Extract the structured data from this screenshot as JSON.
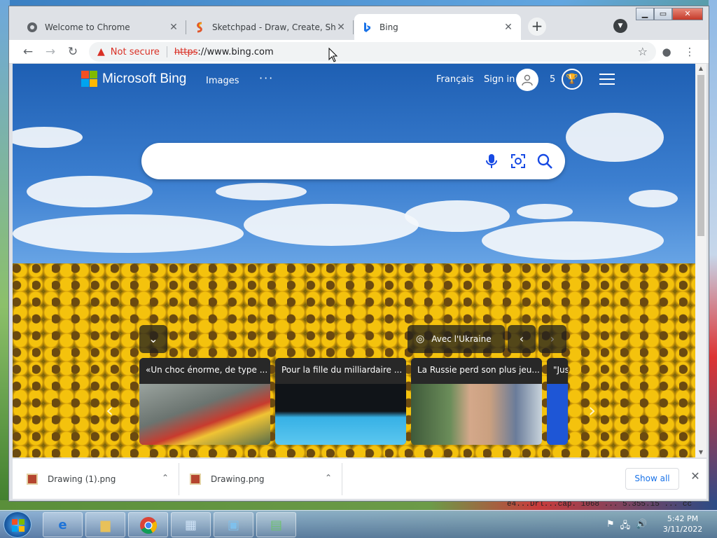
{
  "browser": {
    "tabs": [
      {
        "title": "Welcome to Chrome",
        "icon": "chrome-welcome-icon"
      },
      {
        "title": "Sketchpad - Draw, Create, Share!",
        "icon": "sketchpad-icon"
      },
      {
        "title": "Bing",
        "icon": "bing-icon"
      }
    ],
    "omnibox": {
      "security_label": "Not secure",
      "scheme": "https",
      "rest": "://www.bing.com"
    }
  },
  "bing": {
    "brand": "Microsoft Bing",
    "nav": {
      "images": "Images",
      "more": "···",
      "language": "Français",
      "signin": "Sign in",
      "points": "5"
    },
    "search": {
      "placeholder": ""
    },
    "carousel": {
      "location_label": "Avec l'Ukraine",
      "cards": [
        {
          "caption": "«Un choc énorme, de type ..."
        },
        {
          "caption": "Pour la fille du milliardaire ..."
        },
        {
          "caption": "La Russie perd son plus jeu..."
        },
        {
          "caption": "\"Jus"
        }
      ]
    }
  },
  "downloads": {
    "items": [
      {
        "name": "Drawing (1).png"
      },
      {
        "name": "Drawing.png"
      }
    ],
    "show_all": "Show all"
  },
  "desktop": {
    "background_text": "e4...Drl...cap. 1068 ... 5.355.15 ... cc"
  },
  "taskbar": {
    "time": "5:42 PM",
    "date": "3/11/2022"
  },
  "colors": {
    "accent_blue": "#174ae4",
    "warning_red": "#d93025",
    "chrome_frame": "#dee1e6",
    "ms_red": "#f25022",
    "ms_green": "#7fba00",
    "ms_blue": "#00a4ef",
    "ms_yellow": "#ffb900"
  }
}
